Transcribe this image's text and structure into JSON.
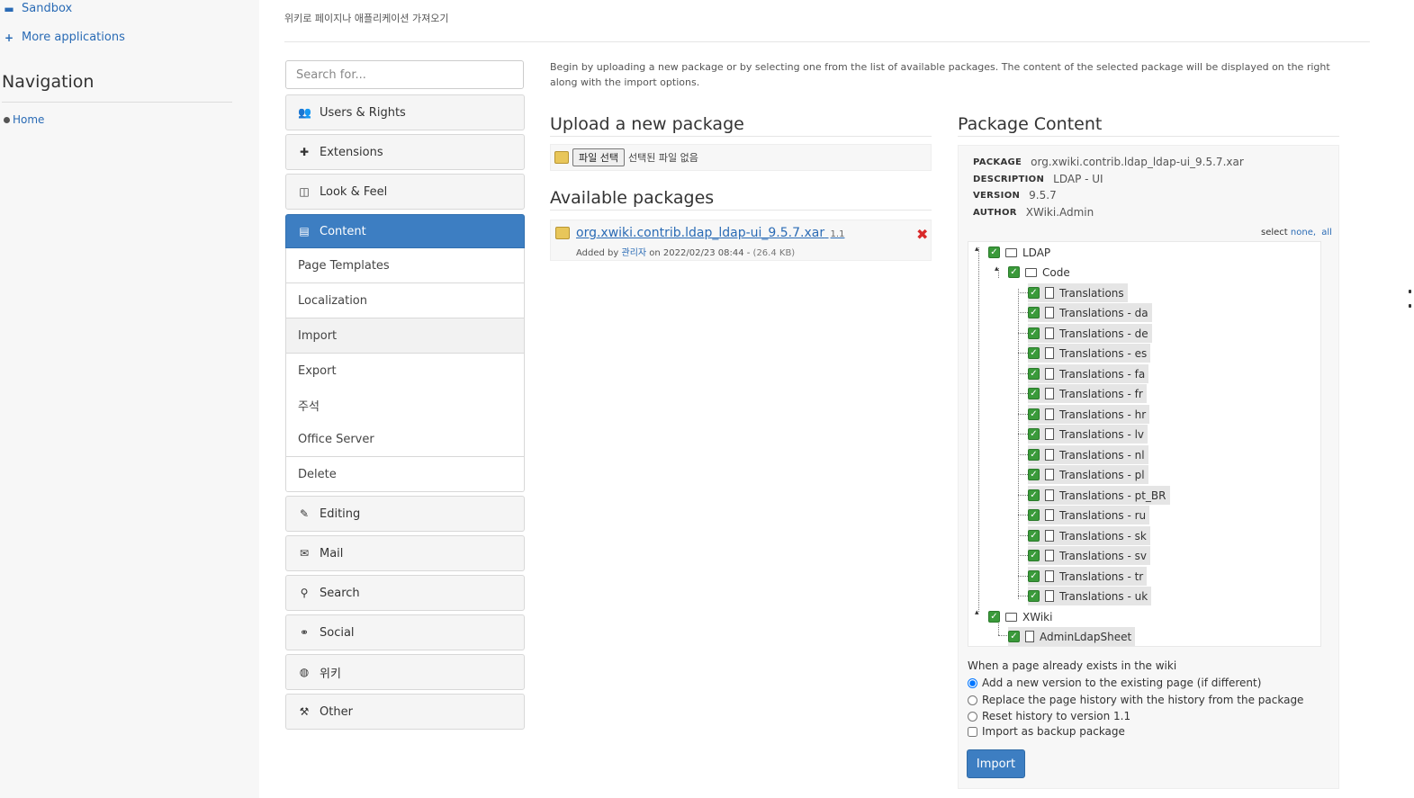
{
  "sidebar": {
    "apps": [
      {
        "label": "Sandbox",
        "icon": "book-icon"
      },
      {
        "label": "More applications",
        "icon": "plus-icon"
      }
    ],
    "nav_title": "Navigation",
    "nav_items": [
      {
        "label": "Home"
      }
    ]
  },
  "header": {
    "hint": "위키로 페이지나 애플리케이션 가져오기"
  },
  "menu": {
    "search_placeholder": "Search for...",
    "categories": [
      {
        "label": "Users & Rights",
        "icon": "users-icon"
      },
      {
        "label": "Extensions",
        "icon": "puzzle-icon"
      },
      {
        "label": "Look & Feel",
        "icon": "layout-icon"
      },
      {
        "label": "Content",
        "icon": "document-icon",
        "active": true
      }
    ],
    "content_items": [
      "Page Templates",
      "Localization",
      "Import",
      "Export",
      "주석",
      "Office Server",
      "Delete"
    ],
    "categories_after": [
      {
        "label": "Editing",
        "icon": "pencil-icon"
      },
      {
        "label": "Mail",
        "icon": "envelope-icon"
      },
      {
        "label": "Search",
        "icon": "magnifier-icon"
      },
      {
        "label": "Social",
        "icon": "link-icon"
      },
      {
        "label": "위키",
        "icon": "globe-icon"
      },
      {
        "label": "Other",
        "icon": "wrench-icon"
      }
    ]
  },
  "import": {
    "intro": "Begin by uploading a new package or by selecting one from the list of available packages. The content of the selected package will be displayed on the right along with the import options.",
    "upload_title": "Upload a new package",
    "choose_file_label": "파일 선택",
    "no_file_text": "선택된 파일 없음",
    "available_title": "Available packages",
    "package": {
      "name": "org.xwiki.contrib.ldap_ldap-ui_9.5.7.xar",
      "version": "1.1",
      "added_by_prefix": "Added by",
      "added_by": "관리자",
      "on_text": "on 2022/02/23 08:44 -",
      "size": "(26.4 KB)"
    }
  },
  "package_content": {
    "title": "Package Content",
    "meta": [
      {
        "key": "PACKAGE",
        "value": "org.xwiki.contrib.ldap_ldap-ui_9.5.7.xar"
      },
      {
        "key": "DESCRIPTION",
        "value": "LDAP - UI"
      },
      {
        "key": "VERSION",
        "value": "9.5.7"
      },
      {
        "key": "AUTHOR",
        "value": "XWiki.Admin"
      }
    ],
    "select_label": "select",
    "select_none": "none,",
    "select_all": "all",
    "tree": {
      "space1": "LDAP",
      "space1_sub": "Code",
      "pages": [
        "Translations",
        "Translations - da",
        "Translations - de",
        "Translations - es",
        "Translations - fa",
        "Translations - fr",
        "Translations - hr",
        "Translations - lv",
        "Translations - nl",
        "Translations - pl",
        "Translations - pt_BR",
        "Translations - ru",
        "Translations - sk",
        "Translations - sv",
        "Translations - tr",
        "Translations - uk"
      ],
      "space2": "XWiki",
      "space2_page": "AdminLdapSheet"
    },
    "options_title": "When a page already exists in the wiki",
    "options": [
      "Add a new version to the existing page (if different)",
      "Replace the page history with the history from the package",
      "Reset history to version 1.1"
    ],
    "backup_label": "Import as backup package",
    "import_button": "Import"
  }
}
